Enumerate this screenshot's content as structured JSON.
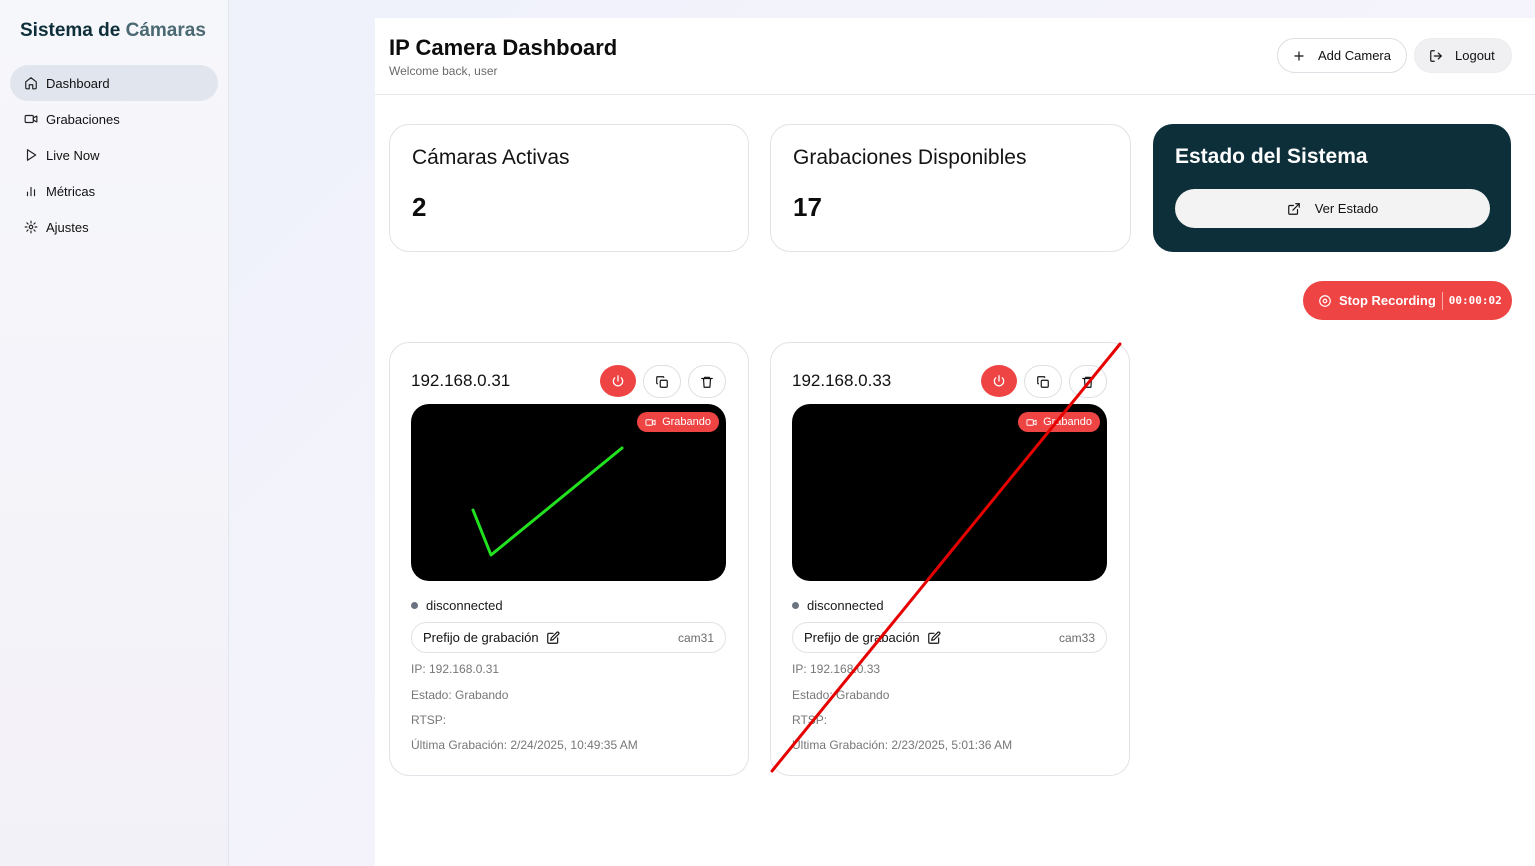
{
  "sidebar": {
    "brand_part1": "Sistema de",
    "brand_part2": "Cámaras",
    "items": [
      {
        "label": "Dashboard",
        "icon": "home-icon",
        "active": true
      },
      {
        "label": "Grabaciones",
        "icon": "video-icon"
      },
      {
        "label": "Live Now",
        "icon": "play-icon"
      },
      {
        "label": "Métricas",
        "icon": "bar-chart-icon"
      },
      {
        "label": "Ajustes",
        "icon": "gear-icon"
      }
    ]
  },
  "header": {
    "title": "IP Camera Dashboard",
    "subtitle": "Welcome back, user",
    "add_camera_label": "Add Camera",
    "logout_label": "Logout"
  },
  "stats": {
    "active_cameras_label": "Cámaras Activas",
    "active_cameras_value": "2",
    "recordings_label": "Grabaciones Disponibles",
    "recordings_value": "17",
    "system_label": "Estado del Sistema",
    "view_status_label": "Ver Estado"
  },
  "recording": {
    "stop_label": "Stop Recording",
    "timer": "00:00:02"
  },
  "cameras": [
    {
      "ip": "192.168.0.31",
      "badge": "Grabando",
      "status": "disconnected",
      "prefix_label": "Prefijo de grabación",
      "prefix_value": "cam31",
      "ip_line": "IP: 192.168.0.31",
      "state_line": "Estado: Grabando",
      "rtsp_line": "RTSP:",
      "last_recording": "Última Grabación: 2/24/2025, 10:49:35 AM"
    },
    {
      "ip": "192.168.0.33",
      "badge": "Grabando",
      "status": "disconnected",
      "prefix_label": "Prefijo de grabación",
      "prefix_value": "cam33",
      "ip_line": "IP: 192.168.0.33",
      "state_line": "Estado: Grabando",
      "rtsp_line": "RTSP:",
      "last_recording": "Última Grabación: 2/23/2025, 5:01:36 AM"
    }
  ],
  "colors": {
    "accent_red": "#ef4444",
    "dark_teal": "#0d2f3a",
    "check_mark": "#22e11f",
    "cross_line": "#e60000"
  }
}
